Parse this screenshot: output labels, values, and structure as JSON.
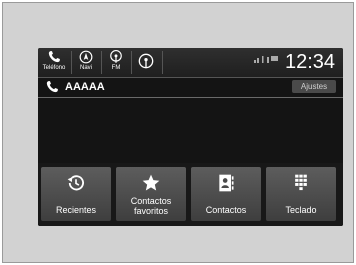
{
  "statusbar": {
    "phone_label": "Teléfono",
    "navi_label": "Navi",
    "fm_label": "FM",
    "clock": "12:34"
  },
  "call": {
    "name": "AAAAA",
    "settings_label": "Ajustes"
  },
  "tiles": [
    {
      "label": "Recientes",
      "icon": "history-icon"
    },
    {
      "label": "Contactos favoritos",
      "icon": "star-icon"
    },
    {
      "label": "Contactos",
      "icon": "contacts-book-icon"
    },
    {
      "label": "Teclado",
      "icon": "keypad-icon"
    }
  ]
}
